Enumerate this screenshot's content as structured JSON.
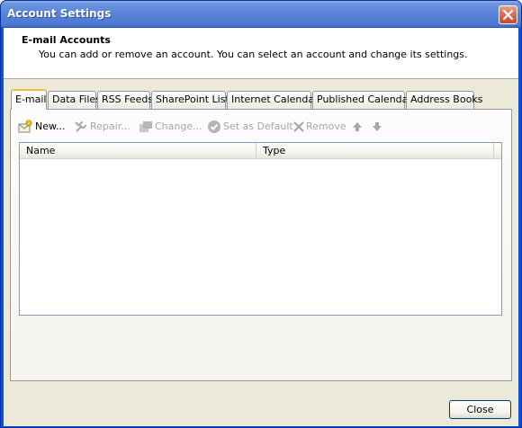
{
  "window": {
    "title": "Account Settings"
  },
  "header": {
    "title": "E-mail Accounts",
    "description": "You can add or remove an account. You can select an account and change its settings."
  },
  "tabs": [
    {
      "label": "E-mail",
      "active": true
    },
    {
      "label": "Data Files",
      "active": false
    },
    {
      "label": "RSS Feeds",
      "active": false
    },
    {
      "label": "SharePoint Lists",
      "active": false
    },
    {
      "label": "Internet Calendars",
      "active": false
    },
    {
      "label": "Published Calendars",
      "active": false
    },
    {
      "label": "Address Books",
      "active": false
    }
  ],
  "toolbar": {
    "new_label": "New...",
    "repair_label": "Repair...",
    "change_label": "Change...",
    "set_default_label": "Set as Default",
    "remove_label": "Remove",
    "move_up_icon": "arrow-up-icon",
    "move_down_icon": "arrow-down-icon"
  },
  "list": {
    "columns": [
      "Name",
      "Type"
    ],
    "rows": []
  },
  "footer": {
    "close_label": "Close"
  },
  "colors": {
    "titlebar_blue": "#5a84d9",
    "dialog_bg": "#ece9d8",
    "active_tab_accent": "#f2b94a",
    "close_red": "#d86d55"
  }
}
